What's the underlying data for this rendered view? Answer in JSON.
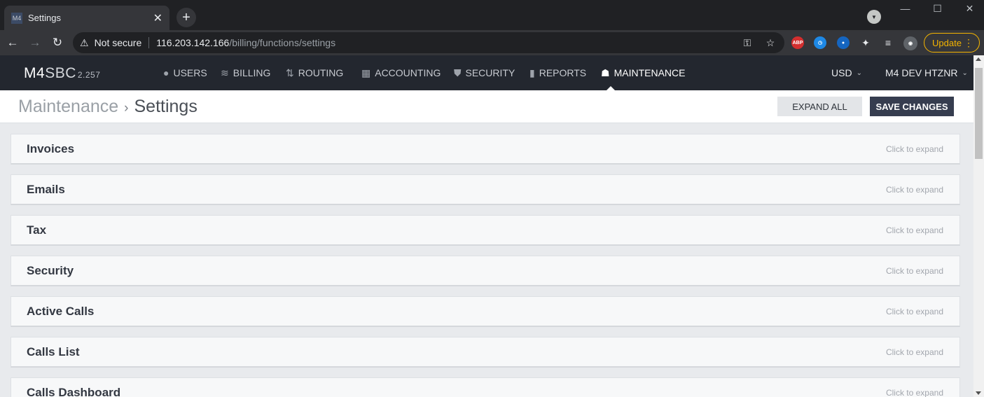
{
  "browser": {
    "tab_title": "Settings",
    "tab_favicon": "M4",
    "security_label": "Not secure",
    "url_host": "116.203.142.166",
    "url_path": "/billing/functions/settings",
    "update_label": "Update"
  },
  "app": {
    "brand_m4": "M4",
    "brand_sbc": "SBC",
    "version": "2.257",
    "nav": [
      {
        "label": "USERS",
        "icon": "user-icon"
      },
      {
        "label": "BILLING",
        "icon": "coins-icon"
      },
      {
        "label": "ROUTING",
        "icon": "routing-icon"
      },
      {
        "label": "ACCOUNTING",
        "icon": "calculator-icon"
      },
      {
        "label": "SECURITY",
        "icon": "shield-icon"
      },
      {
        "label": "REPORTS",
        "icon": "bar-chart-icon"
      },
      {
        "label": "MAINTENANCE",
        "icon": "hard-hat-icon"
      }
    ],
    "currency": "USD",
    "account": "M4 DEV HTZNR"
  },
  "page": {
    "breadcrumb_parent": "Maintenance",
    "breadcrumb_current": "Settings",
    "expand_all_label": "EXPAND ALL",
    "save_label": "SAVE CHANGES"
  },
  "sections": [
    {
      "title": "Invoices",
      "hint": "Click to expand"
    },
    {
      "title": "Emails",
      "hint": "Click to expand"
    },
    {
      "title": "Tax",
      "hint": "Click to expand"
    },
    {
      "title": "Security",
      "hint": "Click to expand"
    },
    {
      "title": "Active Calls",
      "hint": "Click to expand"
    },
    {
      "title": "Calls List",
      "hint": "Click to expand"
    },
    {
      "title": "Calls Dashboard",
      "hint": "Click to expand"
    }
  ],
  "colors": {
    "nav_bg": "#23272f",
    "save_button": "#363d4f",
    "update_accent": "#f4b400"
  }
}
